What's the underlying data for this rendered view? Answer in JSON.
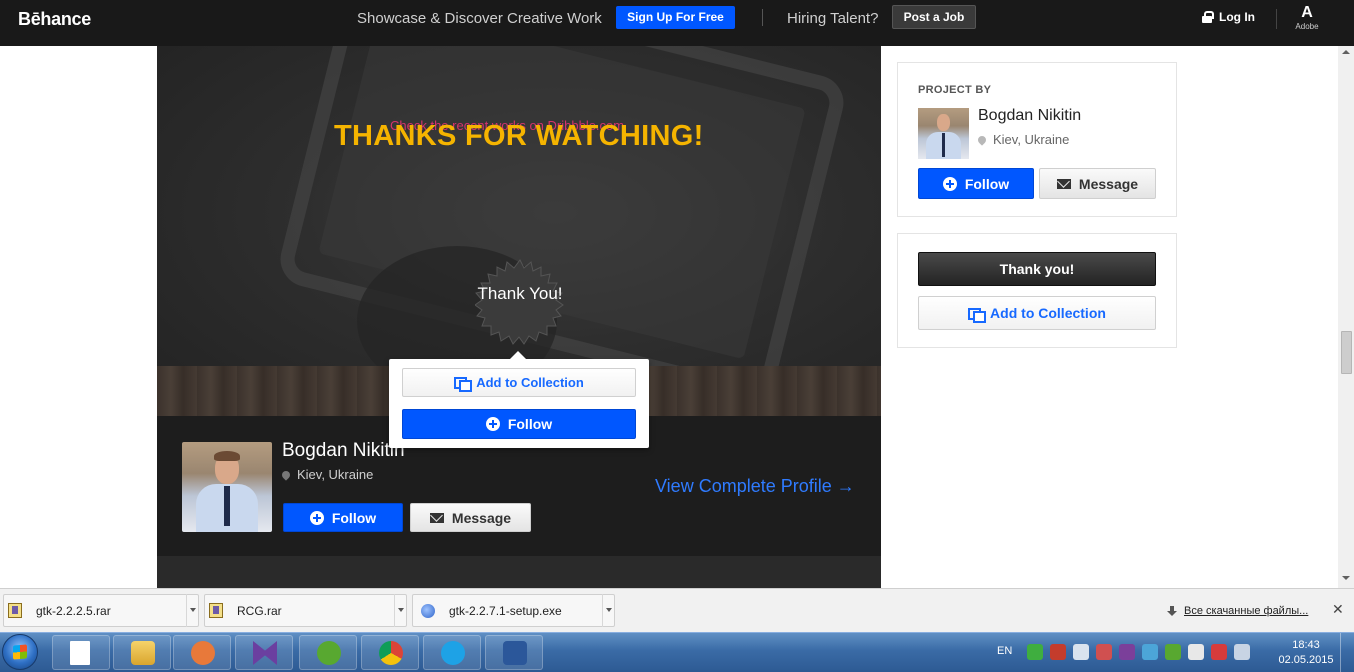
{
  "nav": {
    "logo": "Bēhance",
    "tagline": "Showcase & Discover Creative Work",
    "signup": "Sign Up For Free",
    "hiring": "Hiring Talent?",
    "post_job": "Post a Job",
    "login": "Log In",
    "adobe": "Adobe",
    "brand_color": "#0057ff"
  },
  "project": {
    "dribbble_note": "Check the recent works on Dribbble.com",
    "headline": "THANKS FOR WATCHING!",
    "headline_color": "#f5b400",
    "badge": "Thank You!"
  },
  "popup": {
    "add_collection": "Add to Collection",
    "follow": "Follow"
  },
  "owner": {
    "name": "Bogdan Nikitin",
    "location": "Kiev, Ukraine",
    "follow": "Follow",
    "message": "Message",
    "view_profile": "View Complete Profile →"
  },
  "sidebar": {
    "project_by": "PROJECT BY",
    "name": "Bogdan Nikitin",
    "location": "Kiev, Ukraine",
    "follow": "Follow",
    "message": "Message",
    "thank_you": "Thank you!",
    "add_collection": "Add to Collection"
  },
  "downloads": {
    "items": [
      {
        "name": "gtk-2.2.2.5.rar",
        "icon": "rar-icon"
      },
      {
        "name": "RCG.rar",
        "icon": "rar-icon"
      },
      {
        "name": "gtk-2.2.7.1-setup.exe",
        "icon": "exe-icon"
      }
    ],
    "all_downloads": "Все скачанные файлы...",
    "close": "✕"
  },
  "taskbar": {
    "lang": "EN",
    "time": "18:43",
    "date": "02.05.2015",
    "apps": [
      "file-icon",
      "explorer-icon",
      "media-player-icon",
      "visual-studio-icon",
      "utorrent-icon",
      "chrome-icon",
      "skype-icon",
      "word-icon"
    ]
  }
}
